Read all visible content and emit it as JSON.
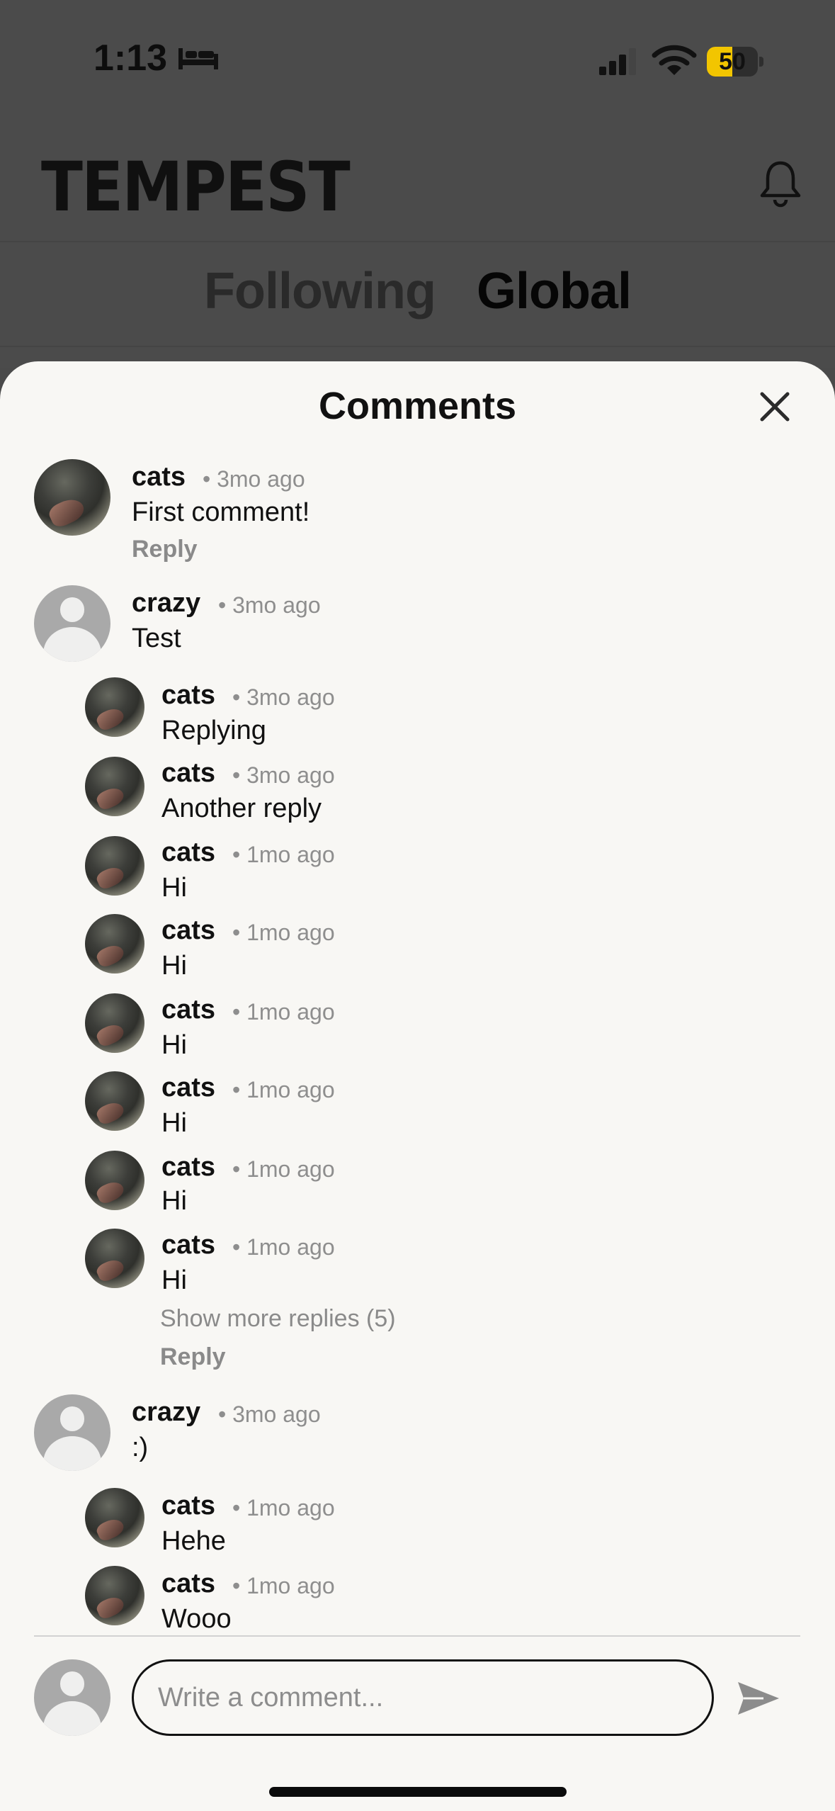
{
  "status_bar": {
    "time": "1:13",
    "battery": "50",
    "battery_level": 0.5
  },
  "header": {
    "logo": "TEMPEST"
  },
  "tabs": [
    {
      "label": "Following"
    },
    {
      "label": "Global"
    }
  ],
  "sheet": {
    "title": "Comments",
    "input_placeholder": "Write a comment..."
  },
  "comments": [
    {
      "user": "cats",
      "time": "• 3mo ago",
      "text": "First comment!",
      "avatar": "photo",
      "reply_label": "Reply"
    },
    {
      "user": "crazy",
      "time": "• 3mo ago",
      "text": "Test",
      "avatar": "default",
      "replies": [
        {
          "user": "cats",
          "time": "• 3mo ago",
          "text": "Replying"
        },
        {
          "user": "cats",
          "time": "• 3mo ago",
          "text": "Another reply"
        },
        {
          "user": "cats",
          "time": "• 1mo ago",
          "text": "Hi"
        },
        {
          "user": "cats",
          "time": "• 1mo ago",
          "text": "Hi"
        },
        {
          "user": "cats",
          "time": "• 1mo ago",
          "text": "Hi"
        },
        {
          "user": "cats",
          "time": "• 1mo ago",
          "text": "Hi"
        },
        {
          "user": "cats",
          "time": "• 1mo ago",
          "text": "Hi"
        },
        {
          "user": "cats",
          "time": "• 1mo ago",
          "text": "Hi"
        }
      ],
      "show_more_label": "Show more replies (5)",
      "reply_label": "Reply"
    },
    {
      "user": "crazy",
      "time": "• 3mo ago",
      "text": ":)",
      "avatar": "default",
      "replies": [
        {
          "user": "cats",
          "time": "• 1mo ago",
          "text": "Hehe"
        },
        {
          "user": "cats",
          "time": "• 1mo ago",
          "text": "Wooo"
        }
      ]
    }
  ]
}
